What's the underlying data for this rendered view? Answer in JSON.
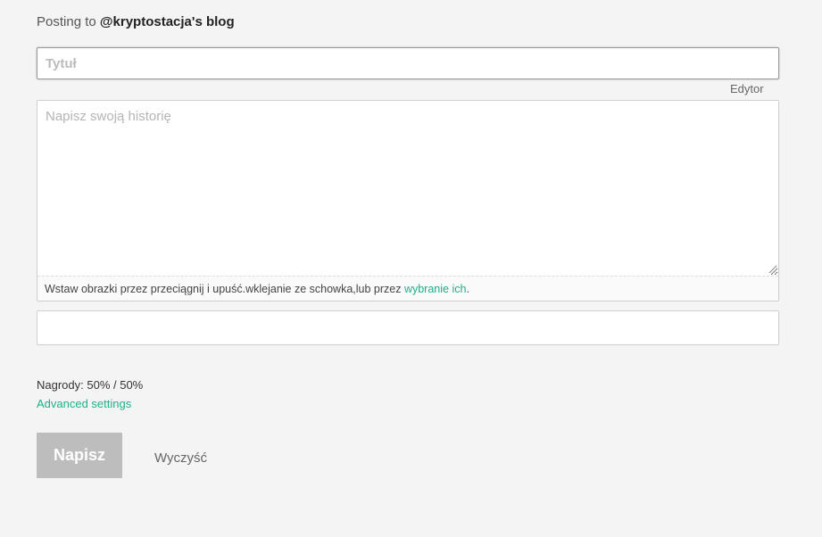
{
  "header": {
    "posting_prefix": "Posting to",
    "blog_name": "@kryptostacja's blog"
  },
  "title_field": {
    "value": "",
    "placeholder": "Tytuł"
  },
  "editor": {
    "toggle_label": "Edytor",
    "story_value": "",
    "story_placeholder": "Napisz swoją historię",
    "drop_hint_text": "Wstaw obrazki przez przeciągnij i upuść.wklejanie ze schowka,lub przez ",
    "drop_hint_link": "wybranie ich",
    "drop_hint_end": "."
  },
  "tags_field": {
    "value": "",
    "placeholder": ""
  },
  "rewards": {
    "label": "Nagrody: 50% / 50%"
  },
  "advanced": {
    "label": "Advanced settings"
  },
  "actions": {
    "submit_label": "Napisz",
    "clear_label": "Wyczyść"
  },
  "colors": {
    "accent": "#1fb089",
    "button_disabled": "#bdbdbd",
    "background": "#f4f4f4"
  }
}
